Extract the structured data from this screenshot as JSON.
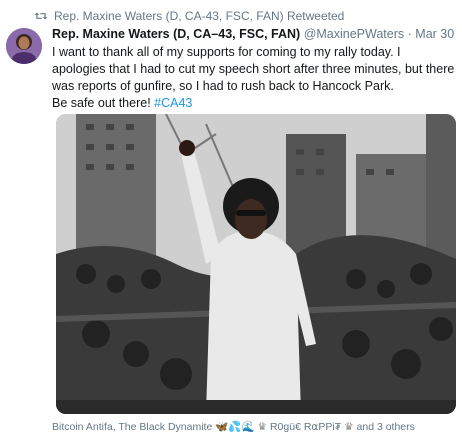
{
  "retweet": {
    "label": "Rep. Maxine Waters (D, CA-43, FSC, FAN) Retweeted"
  },
  "tweet": {
    "author_name": "Rep. Maxine Waters (D, CA–43, FSC, FAN)",
    "handle": "@MaxinePWaters",
    "separator": "·",
    "date": "Mar 30",
    "text_line1": "I want to thank all of my supports for coming to my rally today. I apologies that I had to cut my speech short after three minutes, but there was reports of gunfire, so I had to rush back to Hancock Park.",
    "text_line2_prefix": "Be safe out there! ",
    "hashtag": "#CA43"
  },
  "media": {
    "icon": "photo",
    "colors": {
      "sky": "#cfcfcf",
      "building": "#5b5b5b",
      "crowd": "#2e2e2e",
      "shirt": "#e9e9e9"
    }
  },
  "likers": {
    "name1": "Bitcoin Antifa, The Black Dynamite",
    "emoji1": "🦋💦🌊",
    "emoji2": "♛",
    "name2": "R0gü€ R⍺PPi₮",
    "emoji3": "♛",
    "suffix": "and 3 others"
  },
  "colors": {
    "secondary_text": "#657786",
    "link": "#1b95e0",
    "retweet_icon": "#657786"
  }
}
